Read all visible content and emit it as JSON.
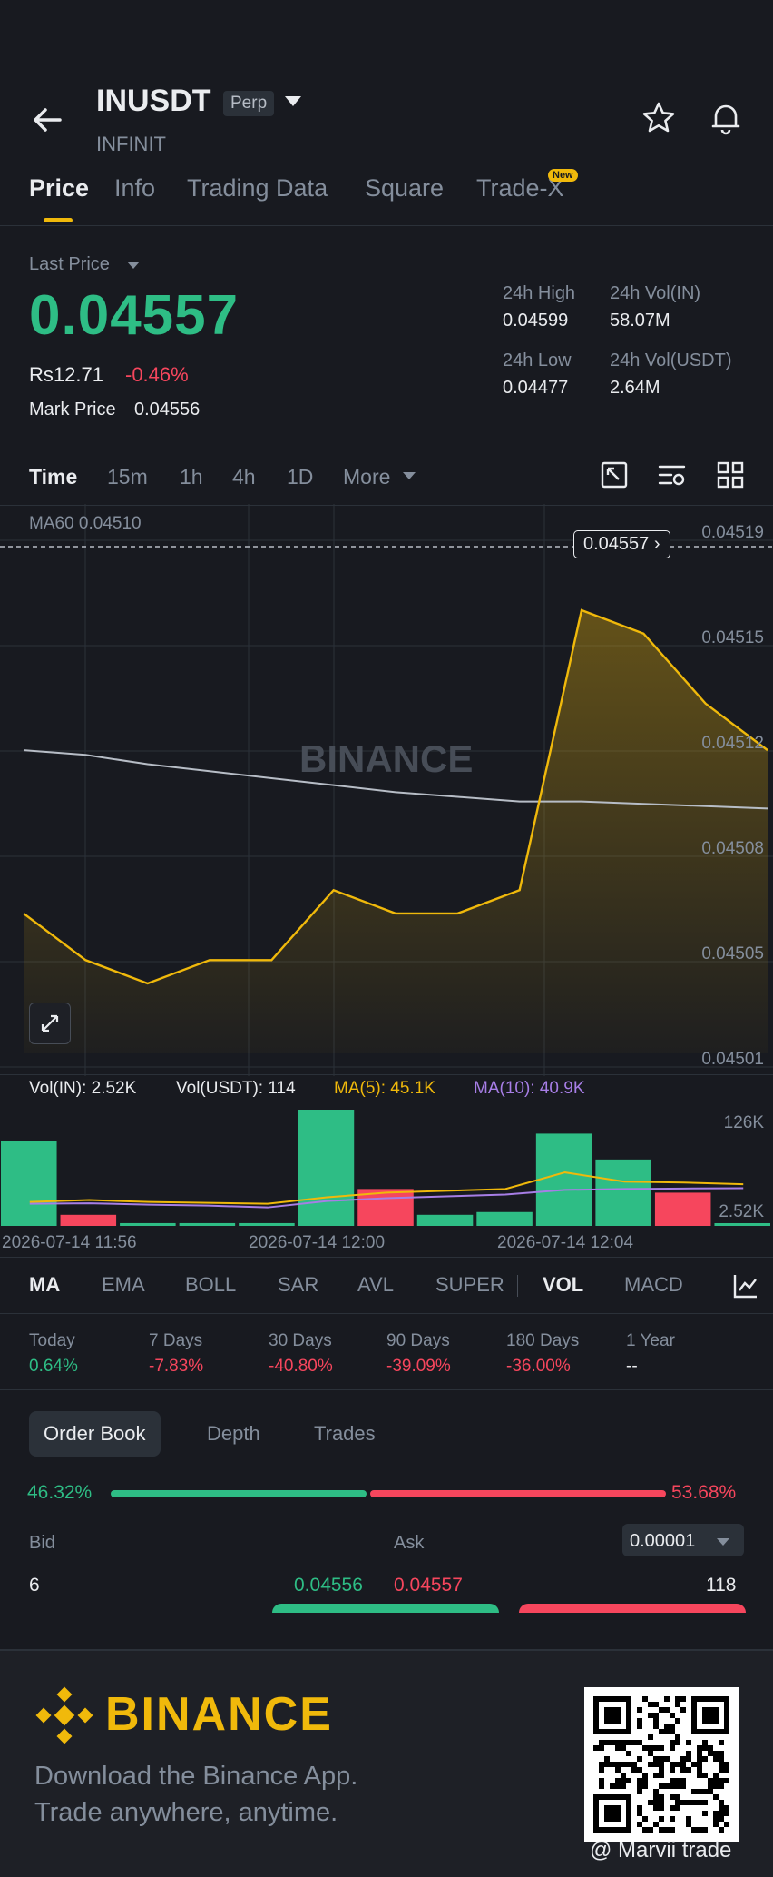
{
  "header": {
    "symbol": "INUSDT",
    "contract_type": "Perp",
    "name": "INFINIT",
    "tabs": [
      {
        "label": "Price",
        "active": true
      },
      {
        "label": "Info"
      },
      {
        "label": "Trading Data"
      },
      {
        "label": "Square"
      },
      {
        "label": "Trade-X",
        "badge": "New"
      }
    ]
  },
  "ticker": {
    "last_price_label": "Last Price",
    "last_price": "0.04557",
    "inr_price": "Rs12.71",
    "change_pct": "-0.46%",
    "mark_price_label": "Mark Price",
    "mark_price": "0.04556",
    "high_label": "24h High",
    "high": "0.04599",
    "low_label": "24h Low",
    "low": "0.04477",
    "vol_base_label": "24h Vol(IN)",
    "vol_base": "58.07M",
    "vol_quote_label": "24h Vol(USDT)",
    "vol_quote": "2.64M"
  },
  "timeframes": {
    "items": [
      "Time",
      "15m",
      "1h",
      "4h",
      "1D",
      "More"
    ],
    "active": "Time"
  },
  "chart_data": {
    "type": "line",
    "indicator_label": "MA60 0.04510",
    "current_price_tag": "0.04557",
    "watermark": "BINANCE",
    "y_ticks": [
      "0.04519",
      "0.04515",
      "0.04512",
      "0.04508",
      "0.04505",
      "0.04501"
    ],
    "ylim": [
      0.04499,
      0.04521
    ],
    "series": [
      {
        "name": "price",
        "color": "#f0b90b",
        "values": [
          0.04505,
          0.04503,
          0.04502,
          0.04503,
          0.04503,
          0.04506,
          0.04505,
          0.04505,
          0.04506,
          0.04518,
          0.04517,
          0.04514,
          0.04512
        ]
      },
      {
        "name": "MA60",
        "color": "#b7bdc6",
        "values": [
          0.04512,
          0.045118,
          0.045114,
          0.045111,
          0.045108,
          0.045105,
          0.045102,
          0.0451,
          0.045098,
          0.045098,
          0.045097,
          0.045096,
          0.045095
        ]
      }
    ],
    "volume": {
      "legend": [
        {
          "text": "Vol(IN): 2.52K",
          "color": "#848e9c"
        },
        {
          "text": "Vol(USDT): 114",
          "color": "#848e9c"
        },
        {
          "text": "MA(5): 45.1K",
          "color": "#f0b90b"
        },
        {
          "text": "MA(10): 40.9K",
          "color": "#a77ee6"
        }
      ],
      "y_ticks": [
        "126K",
        "2.52K"
      ],
      "ylim": [
        0,
        126000
      ],
      "bars": [
        {
          "value": 92000,
          "dir": "up"
        },
        {
          "value": 12000,
          "dir": "down"
        },
        {
          "value": 3000,
          "dir": "up"
        },
        {
          "value": 3000,
          "dir": "up"
        },
        {
          "value": 3000,
          "dir": "up"
        },
        {
          "value": 126000,
          "dir": "up"
        },
        {
          "value": 40000,
          "dir": "down"
        },
        {
          "value": 12000,
          "dir": "up"
        },
        {
          "value": 15000,
          "dir": "up"
        },
        {
          "value": 100000,
          "dir": "up"
        },
        {
          "value": 72000,
          "dir": "up"
        },
        {
          "value": 36000,
          "dir": "down"
        },
        {
          "value": 2520,
          "dir": "up"
        }
      ],
      "ma5": [
        26000,
        28000,
        26000,
        25000,
        24000,
        31000,
        36000,
        38000,
        40000,
        58000,
        48000,
        47000,
        45100
      ],
      "ma10": [
        24000,
        24500,
        23000,
        22000,
        20000,
        27000,
        30000,
        32000,
        34000,
        39000,
        40000,
        40500,
        40900
      ]
    },
    "x_labels": [
      "2026-07-14 11:56",
      "2026-07-14 12:00",
      "2026-07-14 12:04"
    ]
  },
  "indicators": {
    "items": [
      "MA",
      "EMA",
      "BOLL",
      "SAR",
      "AVL",
      "SUPER",
      "VOL",
      "MACD"
    ],
    "active_main": "MA",
    "active_sub": "VOL"
  },
  "performance": [
    {
      "label": "Today",
      "value": "0.64%",
      "dir": "up"
    },
    {
      "label": "7 Days",
      "value": "-7.83%",
      "dir": "down"
    },
    {
      "label": "30 Days",
      "value": "-40.80%",
      "dir": "down"
    },
    {
      "label": "90 Days",
      "value": "-39.09%",
      "dir": "down"
    },
    {
      "label": "180 Days",
      "value": "-36.00%",
      "dir": "down"
    },
    {
      "label": "1 Year",
      "value": "--",
      "dir": "none"
    }
  ],
  "orderbook": {
    "tabs": [
      "Order Book",
      "Depth",
      "Trades"
    ],
    "bid_pct": "46.32%",
    "ask_pct": "53.68%",
    "bid_ratio": 0.4632,
    "bid_label": "Bid",
    "ask_label": "Ask",
    "tick_size": "0.00001",
    "row": {
      "bid_qty": "6",
      "bid_price": "0.04556",
      "ask_price": "0.04557",
      "ask_qty": "118"
    }
  },
  "footer": {
    "brand": "BINANCE",
    "line1": "Download the Binance App.",
    "line2": "Trade anywhere, anytime.",
    "credit": "@ Marvii trade"
  },
  "colors": {
    "up": "#2ebd85",
    "down": "#f6465d",
    "accent": "#f0b90b",
    "bg": "#181a20"
  }
}
